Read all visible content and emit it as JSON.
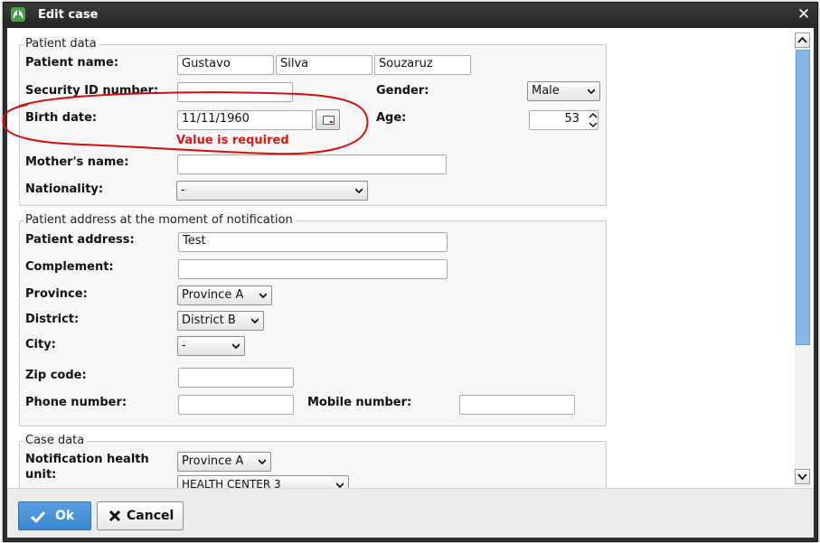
{
  "window": {
    "title": "Edit case"
  },
  "patient_data": {
    "legend": "Patient data",
    "name_label": "Patient name:",
    "first_name": "Gustavo",
    "middle_name": "Silva",
    "last_name": "Souzaruz",
    "security_id_label": "Security ID number:",
    "security_id": "",
    "gender_label": "Gender:",
    "gender": "Male",
    "birth_date_label": "Birth date:",
    "birth_date": "11/11/1960",
    "birth_date_error": "Value is required",
    "age_label": "Age:",
    "age": "53",
    "mother_name_label": "Mother's name:",
    "mother_name": "",
    "nationality_label": "Nationality:",
    "nationality": "-"
  },
  "address": {
    "legend": "Patient address at the moment of notification",
    "address_label": "Patient address:",
    "address": "Test",
    "complement_label": "Complement:",
    "complement": "",
    "province_label": "Province:",
    "province": "Province A",
    "district_label": "District:",
    "district": "District B",
    "city_label": "City:",
    "city": "-",
    "zip_label": "Zip code:",
    "zip": "",
    "phone_label": "Phone number:",
    "phone": "",
    "mobile_label": "Mobile number:",
    "mobile": ""
  },
  "case_data": {
    "legend": "Case data",
    "notification_unit_label": "Notification health unit:",
    "notification_province": "Province A",
    "notification_unit": "HEALTH CENTER 3"
  },
  "footer": {
    "ok_label": "Ok",
    "cancel_label": "Cancel"
  },
  "colors": {
    "error": "#d21a1a",
    "annotation": "#d01010",
    "ok_button": "#3d86cf",
    "titlebar": "#2e2e2e"
  },
  "icons": {
    "app": "lungs-icon",
    "close": "close-icon",
    "ok": "check-icon",
    "cancel": "x-icon",
    "calendar": "calendar-icon"
  }
}
